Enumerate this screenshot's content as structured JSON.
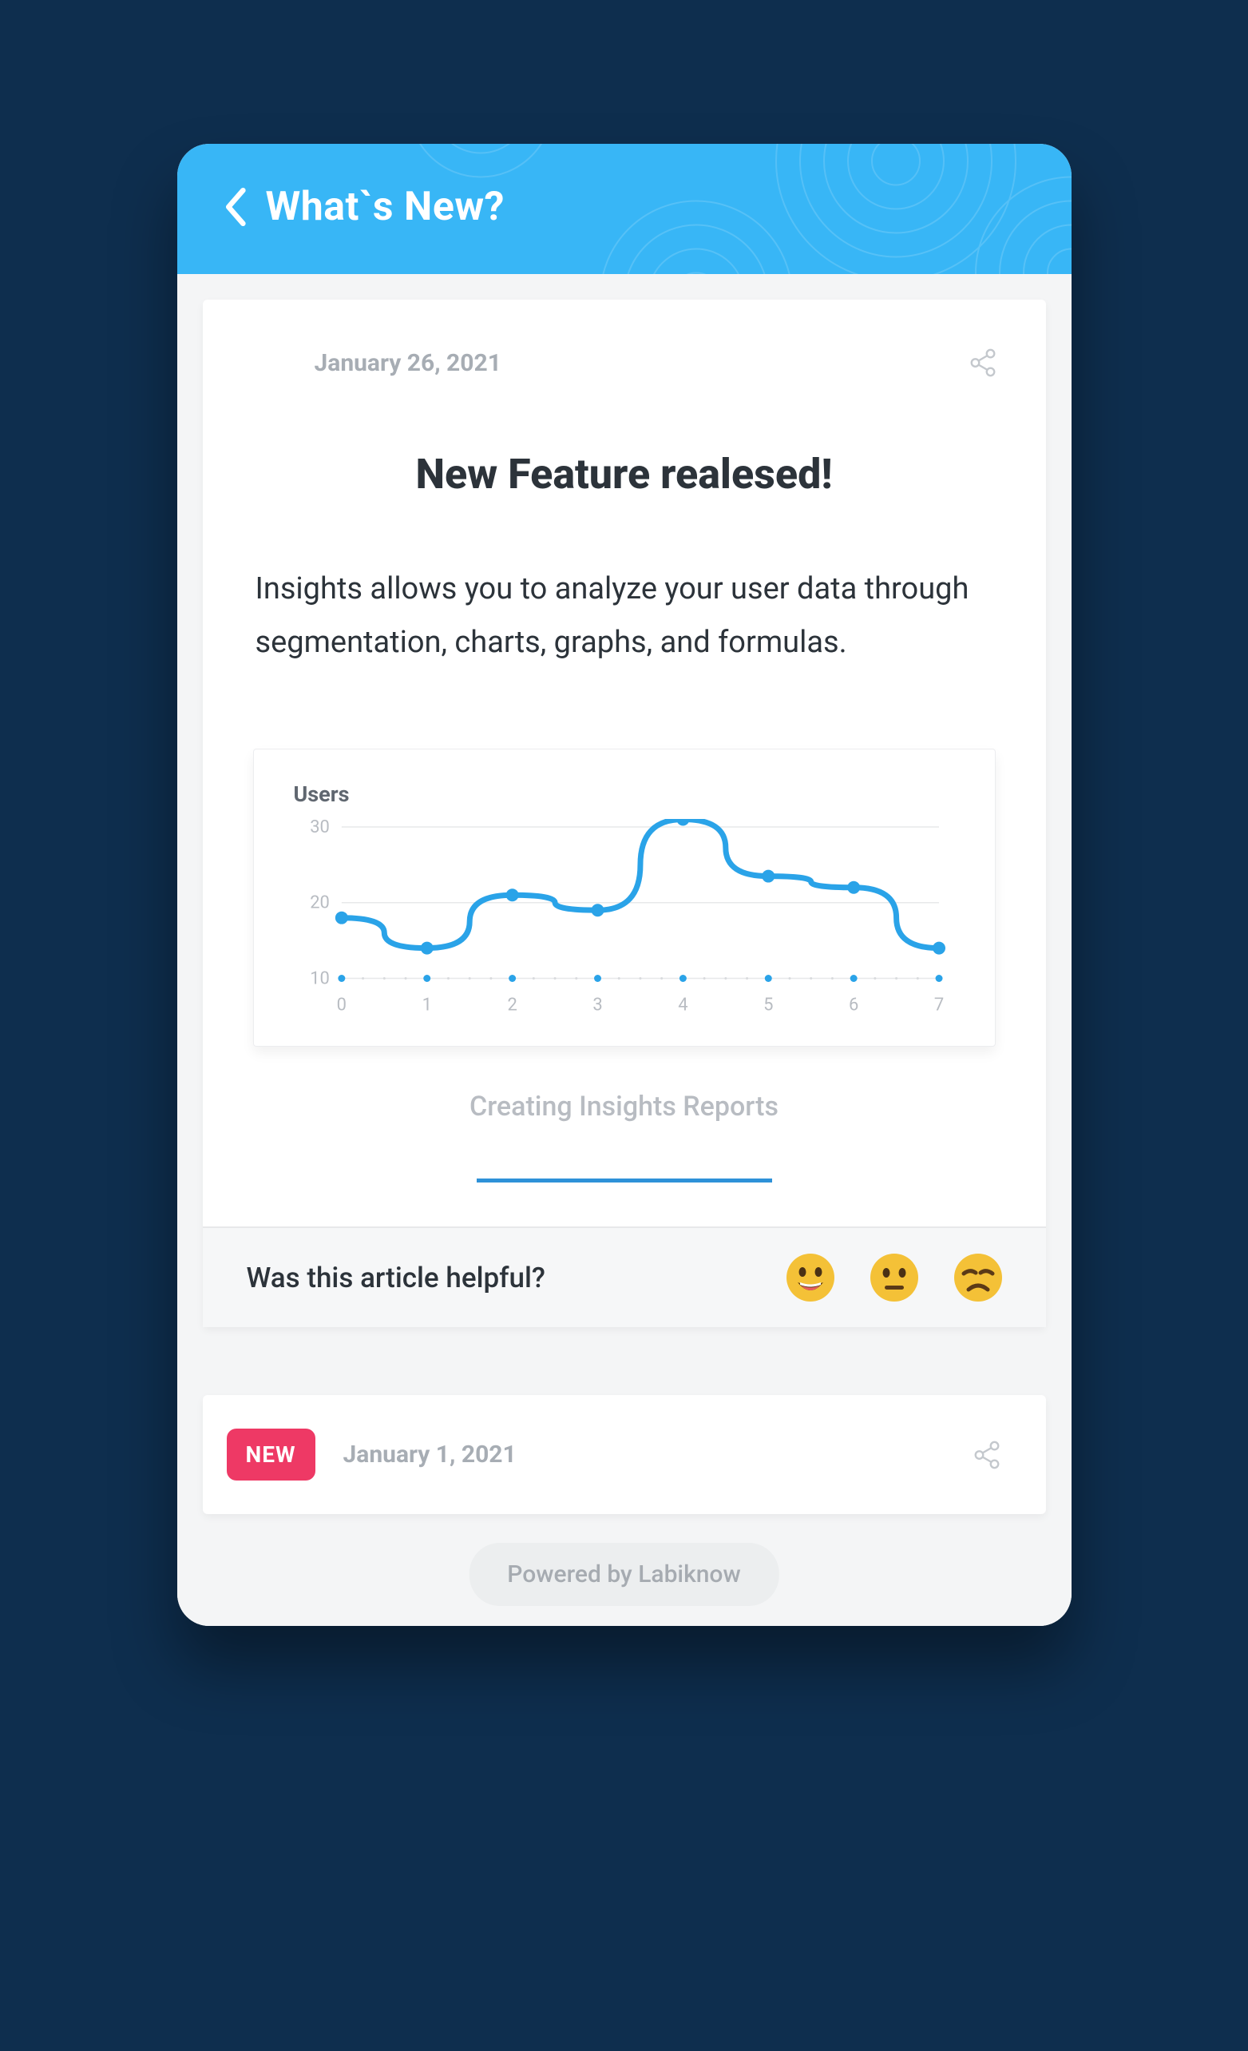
{
  "header": {
    "title": "What`s New?"
  },
  "article1": {
    "date": "January 26, 2021",
    "title": "New Feature realesed!",
    "body": "Insights allows you to analyze your user data through segmentation, charts, graphs, and formulas.",
    "chart_caption": "Creating Insights Reports"
  },
  "feedback": {
    "question": "Was this article helpful?"
  },
  "article2": {
    "badge": "NEW",
    "date": "January 1, 2021"
  },
  "footer": {
    "powered": "Powered by Labiknow"
  },
  "chart_data": {
    "type": "line",
    "title": "Users",
    "xlabel": "",
    "ylabel": "",
    "ylim": [
      10,
      30
    ],
    "x": [
      0,
      1,
      2,
      3,
      4,
      5,
      6,
      7
    ],
    "values": [
      18,
      14,
      21,
      19,
      31,
      23.5,
      22,
      14
    ]
  }
}
